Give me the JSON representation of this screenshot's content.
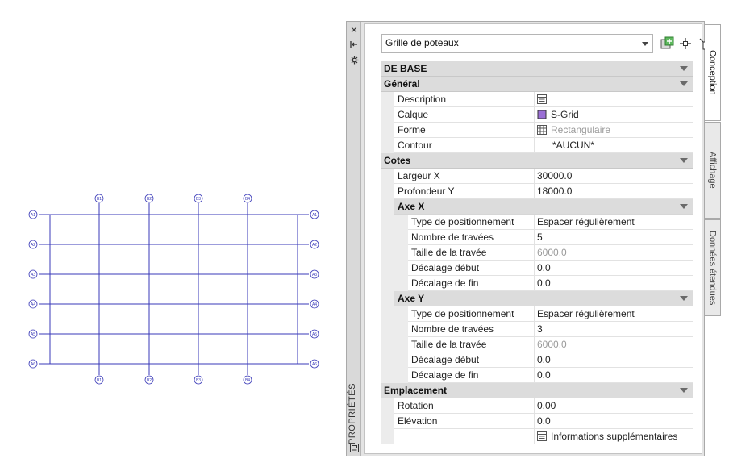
{
  "grid_drawing": {
    "top_bubbles": [
      "B1",
      "B2",
      "B3",
      "B4"
    ],
    "bottom_bubbles": [
      "B1",
      "B2",
      "B3",
      "B4"
    ],
    "left_bubbles": [
      "A1",
      "A2",
      "A3",
      "A4",
      "A5",
      "A6"
    ],
    "right_bubbles": [
      "A1",
      "A2",
      "A3",
      "A4",
      "A5",
      "A6"
    ],
    "line_color": "#3a3ab8"
  },
  "palette": {
    "title": "PROPRIÉTÉS",
    "style_value": "Grille de poteaux",
    "tabs": [
      "Conception",
      "Affichage",
      "Données étendues"
    ]
  },
  "rows": [
    {
      "type": "category",
      "label": "DE BASE"
    },
    {
      "type": "sub0",
      "label": "Général"
    },
    {
      "type": "prop",
      "level": 1,
      "label": "Description",
      "value": "",
      "icon": "description-icon"
    },
    {
      "type": "prop",
      "level": 1,
      "label": "Calque",
      "value": "S-Grid",
      "icon": "layer-color-swatch"
    },
    {
      "type": "prop",
      "level": 1,
      "label": "Forme",
      "value": "Rectangulaire",
      "icon": "grid-shape-icon",
      "ro": true
    },
    {
      "type": "prop",
      "level": 1,
      "label": "Contour",
      "value": "*AUCUN*",
      "indent_value": true
    },
    {
      "type": "sub0",
      "label": "Cotes"
    },
    {
      "type": "prop",
      "level": 1,
      "label": "Largeur X",
      "value": "30000.0"
    },
    {
      "type": "prop",
      "level": 1,
      "label": "Profondeur Y",
      "value": "18000.0"
    },
    {
      "type": "sub1",
      "label": "Axe X"
    },
    {
      "type": "prop",
      "level": 2,
      "label": "Type de positionnement",
      "value": "Espacer régulièrement"
    },
    {
      "type": "prop",
      "level": 2,
      "label": "Nombre de travées",
      "value": "5"
    },
    {
      "type": "prop",
      "level": 2,
      "label": "Taille de la travée",
      "value": "6000.0",
      "ro": true
    },
    {
      "type": "prop",
      "level": 2,
      "label": "Décalage début",
      "value": "0.0"
    },
    {
      "type": "prop",
      "level": 2,
      "label": "Décalage de fin",
      "value": "0.0"
    },
    {
      "type": "sub1",
      "label": "Axe Y"
    },
    {
      "type": "prop",
      "level": 2,
      "label": "Type de positionnement",
      "value": "Espacer régulièrement"
    },
    {
      "type": "prop",
      "level": 2,
      "label": "Nombre de travées",
      "value": "3"
    },
    {
      "type": "prop",
      "level": 2,
      "label": "Taille de la travée",
      "value": "6000.0",
      "ro": true
    },
    {
      "type": "prop",
      "level": 2,
      "label": "Décalage début",
      "value": "0.0"
    },
    {
      "type": "prop",
      "level": 2,
      "label": "Décalage de fin",
      "value": "0.0"
    },
    {
      "type": "sub0",
      "label": "Emplacement"
    },
    {
      "type": "prop",
      "level": 1,
      "label": "Rotation",
      "value": "0.00"
    },
    {
      "type": "prop",
      "level": 1,
      "label": "Elévation",
      "value": "0.0"
    },
    {
      "type": "prop",
      "level": 1,
      "label": "",
      "value": "Informations supplémentaires",
      "icon": "description-icon"
    }
  ],
  "colors": {
    "layer_swatch": "#9b6fd6",
    "grid_lines": "#3a3ab8"
  }
}
